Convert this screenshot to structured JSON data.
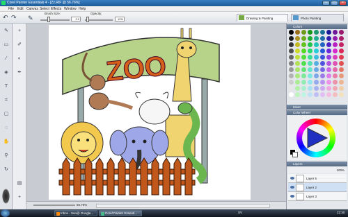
{
  "window": {
    "title": "Corel Painter Essentials 4 - [Zz.RIF @ 56.76%]"
  },
  "menu": [
    "File",
    "Edit",
    "Canvas",
    "Select",
    "Effects",
    "Window",
    "Help"
  ],
  "propbar": {
    "brush_size_label": "Brush Size:",
    "brush_size_value": "2.2",
    "opacity_label": "Opacity:",
    "opacity_value": "12%"
  },
  "tabs": {
    "drawing": "Drawing & Painting",
    "photo": "Photo Painting"
  },
  "panels": {
    "colors": "Colors",
    "mixer": "Mixer",
    "color_wheel": "Color Wheel",
    "layers": "Layers",
    "layer_opacity": "100%"
  },
  "layers": [
    {
      "name": "Layer 5"
    },
    {
      "name": "Layer 2"
    },
    {
      "name": "Layer 3"
    }
  ],
  "status": {
    "zoom": "56.76%"
  },
  "taskbar": {
    "tasks": [
      "Inbox - Sun@ Google...",
      "Corel Painter Essenti..."
    ],
    "lang": "SV",
    "time": "22:30"
  },
  "artwork": {
    "sign_text": "ZOO"
  },
  "colors": {
    "accent": "#4a6fa5",
    "sign": "#b7d38a",
    "fence": "#c0581c"
  }
}
